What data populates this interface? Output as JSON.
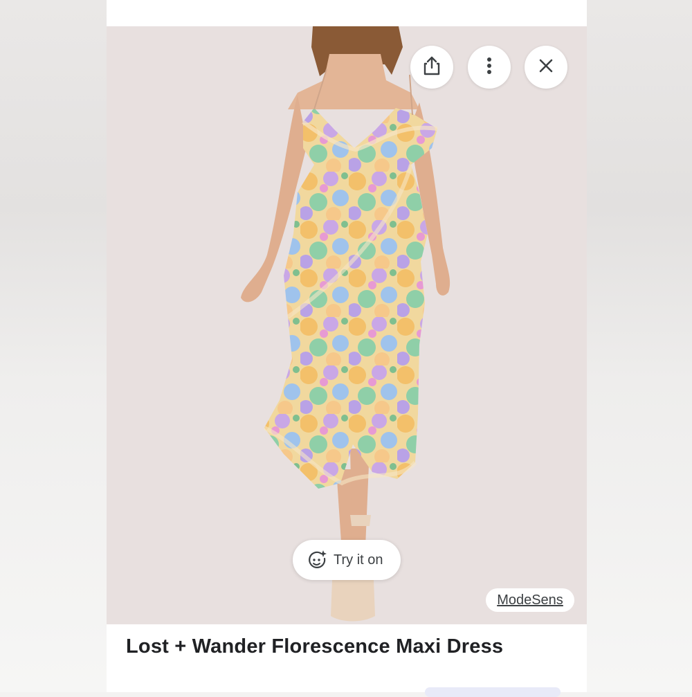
{
  "actions": {
    "share_icon": "share-icon",
    "more_icon": "more-vertical-icon",
    "close_icon": "close-icon"
  },
  "try_on": {
    "label": "Try it on",
    "icon": "sparkle-face-icon"
  },
  "source": {
    "label": "ModeSens"
  },
  "product": {
    "title": "Lost + Wander Florescence Maxi Dress"
  },
  "colors": {
    "image_background": "#e8e0df",
    "title_text": "#202124",
    "secondary_text": "#3c4043"
  }
}
